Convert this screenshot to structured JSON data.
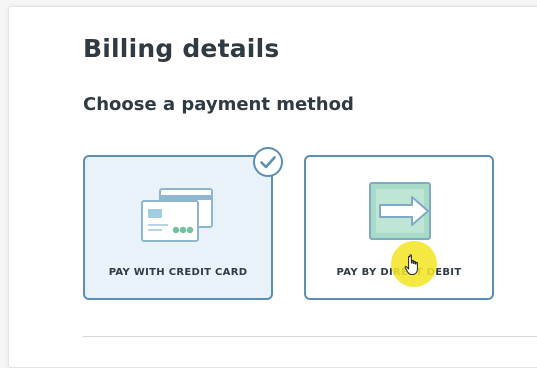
{
  "billing": {
    "title": "Billing details",
    "subtitle": "Choose a payment method"
  },
  "options": [
    {
      "label": "PAY WITH CREDIT CARD",
      "icon": "credit-card-icon",
      "selected": true
    },
    {
      "label": "PAY BY DIRECT DEBIT",
      "icon": "direct-debit-icon",
      "selected": false
    }
  ],
  "colors": {
    "accent": "#5b8fb5",
    "selected_bg": "#e8f2f8",
    "title_text": "#2f3a42",
    "debit_green": "#a8dcc6",
    "highlight": "#f4e528"
  },
  "cursor": {
    "icon": "hand-pointer-icon"
  }
}
